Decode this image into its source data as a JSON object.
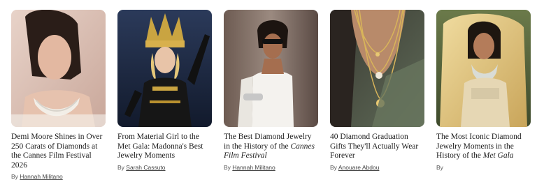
{
  "articles": [
    {
      "image_alt": "Woman with diamond necklace",
      "title": "Demi Moore Shines in Over 250 Carats of Diamonds at the Cannes Film Festival 2026",
      "byline_prefix": "By",
      "author": "Hannah Militano"
    },
    {
      "image_alt": "Performer in gold headdress",
      "title": "From Material Girl to the Met Gala: Madonna's Best Jewelry Moments",
      "byline_prefix": "By",
      "author": "Sarah Cassuto"
    },
    {
      "image_alt": "Woman in white dress and sunglasses",
      "title_plain": "The Best Diamond Jewelry in the History of the ",
      "title_italic": "Cannes Film Festival",
      "byline_prefix": "By",
      "author": "Hannah Militano"
    },
    {
      "image_alt": "Layered gold necklaces",
      "title": "40 Diamond Graduation Gifts They'll Actually Wear Forever",
      "byline_prefix": "By",
      "author": "Anouare Abdou"
    },
    {
      "image_alt": "Woman in gold gown with diamond necklace",
      "title_plain": "The Most Iconic Diamond Jewelry Moments in the History of the ",
      "title_italic": "Met Gala",
      "byline_prefix": "By",
      "author": ""
    }
  ]
}
